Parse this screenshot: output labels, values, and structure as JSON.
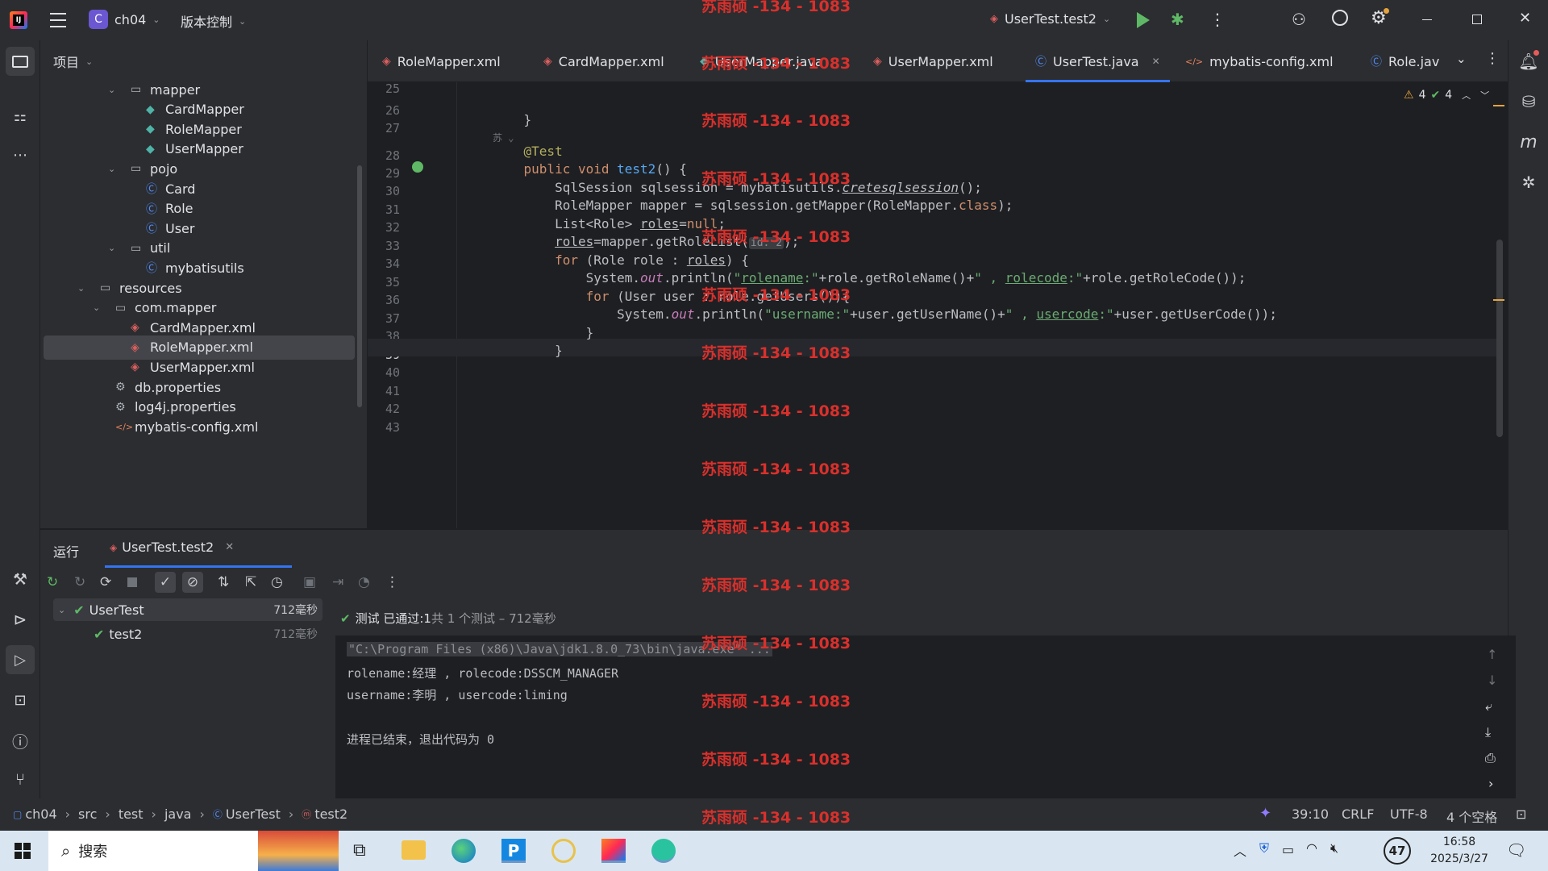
{
  "titlebar": {
    "project_badge": "C",
    "project_name": "ch04",
    "vcs_menu": "版本控制",
    "run_config": "UserTest.test2"
  },
  "project_panel": {
    "title": "项目",
    "tree": [
      {
        "label": "mapper",
        "type": "folder",
        "depth": 5
      },
      {
        "label": "CardMapper",
        "type": "interface",
        "depth": 6
      },
      {
        "label": "RoleMapper",
        "type": "interface",
        "depth": 6
      },
      {
        "label": "UserMapper",
        "type": "interface",
        "depth": 6
      },
      {
        "label": "pojo",
        "type": "folder",
        "depth": 5
      },
      {
        "label": "Card",
        "type": "class",
        "depth": 6
      },
      {
        "label": "Role",
        "type": "class",
        "depth": 6
      },
      {
        "label": "User",
        "type": "class",
        "depth": 6
      },
      {
        "label": "util",
        "type": "folder",
        "depth": 5
      },
      {
        "label": "mybatisutils",
        "type": "class",
        "depth": 6
      },
      {
        "label": "resources",
        "type": "resfolder",
        "depth": 3
      },
      {
        "label": "com.mapper",
        "type": "folder",
        "depth": 4
      },
      {
        "label": "CardMapper.xml",
        "type": "xml",
        "depth": 5
      },
      {
        "label": "RoleMapper.xml",
        "type": "xml",
        "depth": 5,
        "selected": true
      },
      {
        "label": "UserMapper.xml",
        "type": "xml",
        "depth": 5
      },
      {
        "label": "db.properties",
        "type": "props",
        "depth": 4
      },
      {
        "label": "log4j.properties",
        "type": "props",
        "depth": 4
      },
      {
        "label": "mybatis-config.xml",
        "type": "xmlconf",
        "depth": 4
      }
    ]
  },
  "editor_tabs": [
    {
      "label": "RoleMapper.xml",
      "type": "xml"
    },
    {
      "label": "CardMapper.xml",
      "type": "xml"
    },
    {
      "label": "UserMapper.java",
      "type": "interface"
    },
    {
      "label": "UserMapper.xml",
      "type": "xml"
    },
    {
      "label": "UserTest.java",
      "type": "class",
      "active": true
    },
    {
      "label": "mybatis-config.xml",
      "type": "xmlconf"
    },
    {
      "label": "Role.jav",
      "type": "class"
    }
  ],
  "inspections": {
    "warnings": "4",
    "ok": "4"
  },
  "code": {
    "line_numbers": [
      "25",
      "26",
      "27",
      "",
      "28",
      "29",
      "30",
      "31",
      "32",
      "33",
      "34",
      "35",
      "36",
      "37",
      "38",
      "39",
      "40",
      "41",
      "42",
      "43"
    ],
    "inlay_hint": "苏",
    "param_hint": "id: 2"
  },
  "run_panel": {
    "tab_label": "运行",
    "config_tab": "UserTest.test2",
    "status_prefix": "测试 已通过:",
    "status_count": "1",
    "status_suffix": "共 1 个测试 – 712毫秒",
    "tests": [
      {
        "name": "UserTest",
        "time": "712毫秒"
      },
      {
        "name": "test2",
        "time": "712毫秒"
      }
    ],
    "console": [
      "\"C:\\Program Files (x86)\\Java\\jdk1.8.0_73\\bin\\java.exe\" ...",
      "rolename:经理 , rolecode:DSSCM_MANAGER",
      "username:李明 , usercode:liming",
      "",
      "进程已结束，退出代码为 0"
    ]
  },
  "statusbar": {
    "breadcrumb": [
      "ch04",
      "src",
      "test",
      "java",
      "UserTest",
      "test2"
    ],
    "position": "39:10",
    "line_sep": "CRLF",
    "encoding": "UTF-8",
    "indent": "4 个空格"
  },
  "watermark": "苏雨硕 -134 - 1083",
  "taskbar": {
    "search": "搜索",
    "badge": "47",
    "time": "16:58",
    "date": "2025/3/27"
  }
}
